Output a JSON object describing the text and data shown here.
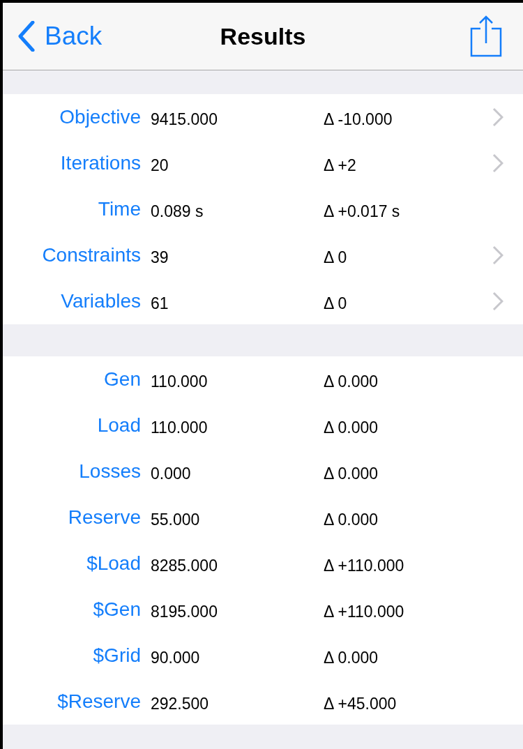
{
  "nav": {
    "back": "Back",
    "title": "Results"
  },
  "sections": [
    {
      "rows": [
        {
          "label": "Objective",
          "value": "9415.000",
          "delta": "Δ -10.000",
          "disclosure": true
        },
        {
          "label": "Iterations",
          "value": "20",
          "delta": "Δ +2",
          "disclosure": true
        },
        {
          "label": "Time",
          "value": "0.089 s",
          "delta": "Δ +0.017 s",
          "disclosure": false
        },
        {
          "label": "Constraints",
          "value": "39",
          "delta": "Δ 0",
          "disclosure": true
        },
        {
          "label": "Variables",
          "value": "61",
          "delta": "Δ 0",
          "disclosure": true
        }
      ]
    },
    {
      "rows": [
        {
          "label": "Gen",
          "value": "110.000",
          "delta": "Δ 0.000",
          "disclosure": false
        },
        {
          "label": "Load",
          "value": "110.000",
          "delta": "Δ 0.000",
          "disclosure": false
        },
        {
          "label": "Losses",
          "value": "0.000",
          "delta": "Δ 0.000",
          "disclosure": false
        },
        {
          "label": "Reserve",
          "value": "55.000",
          "delta": "Δ 0.000",
          "disclosure": false
        },
        {
          "label": "$Load",
          "value": "8285.000",
          "delta": "Δ +110.000",
          "disclosure": false
        },
        {
          "label": "$Gen",
          "value": "8195.000",
          "delta": "Δ +110.000",
          "disclosure": false
        },
        {
          "label": "$Grid",
          "value": "90.000",
          "delta": "Δ 0.000",
          "disclosure": false
        },
        {
          "label": "$Reserve",
          "value": "292.500",
          "delta": "Δ +45.000",
          "disclosure": false
        }
      ]
    }
  ]
}
